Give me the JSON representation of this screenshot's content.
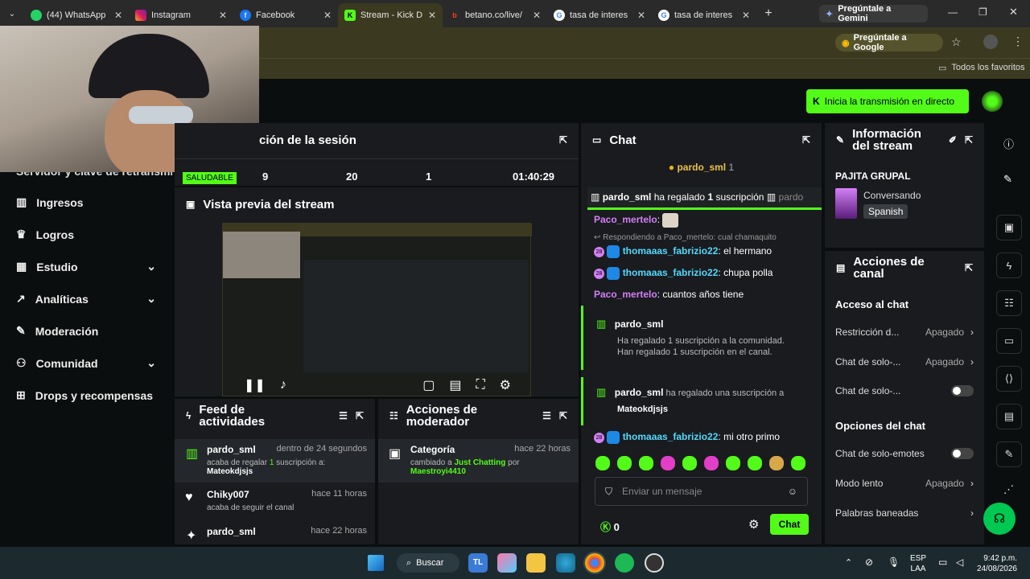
{
  "browser": {
    "tabs": [
      {
        "label": "(44) WhatsApp"
      },
      {
        "label": "Instagram"
      },
      {
        "label": "Facebook"
      },
      {
        "label": "Stream - Kick D"
      },
      {
        "label": "betano.co/live/"
      },
      {
        "label": "tasa de interes"
      },
      {
        "label": "tasa de interes"
      }
    ],
    "gemini_tab": "Pregúntale a Gemini",
    "ask_google": "Pregúntale a Google",
    "all_bookmarks": "Todos los favoritos"
  },
  "header": {
    "go_live": "Inicia la transmisión en directo"
  },
  "sidebar": {
    "partial": "Servidor y clave de retransmisión",
    "items": [
      {
        "label": "Ingresos"
      },
      {
        "label": "Logros"
      },
      {
        "label": "Estudio"
      },
      {
        "label": "Analíticas"
      },
      {
        "label": "Moderación"
      },
      {
        "label": "Comunidad"
      },
      {
        "label": "Drops y recompensas"
      }
    ]
  },
  "session": {
    "title": "ción de la sesión",
    "status": "SALUDABLE",
    "stats": [
      "9",
      "20",
      "1",
      "01:40:29"
    ]
  },
  "preview": {
    "title": "Vista previa del stream"
  },
  "activity": {
    "title": "Feed de actividades",
    "items": [
      {
        "user": "pardo_sml",
        "time": "dentro de 24 segundos",
        "pre": "acaba de regalar ",
        "num": "1",
        "post": " suscripción a:",
        "target": "Mateokdjsjs"
      },
      {
        "user": "Chiky007",
        "time": "hace 11 horas",
        "desc": "acaba de seguir el canal"
      },
      {
        "user": "pardo_sml",
        "time": "hace 22 horas"
      }
    ]
  },
  "modactions": {
    "title": "Acciones de moderador",
    "item": {
      "label": "Categoría",
      "time": "hace 22 horas",
      "pre": "cambiado a ",
      "cat": "Just Chatting",
      "by": " por ",
      "mod": "Maestroyi4410"
    }
  },
  "chat": {
    "title": "Chat",
    "pinned_user": "pardo_sml",
    "pinned_count": "1",
    "gift_banner": {
      "user": "pardo_sml",
      "pre": " ha regalado ",
      "num": "1",
      "post": " suscripción",
      "trail": "pardo"
    },
    "msgs": [
      {
        "user": "Paco_mertelo",
        "text": ":"
      },
      {
        "reply": "Respondiendo a Paco_mertelo: cual chamaquito"
      },
      {
        "user": "thomaaas_fabrizio22",
        "text": ": el hermano"
      },
      {
        "user": "thomaaas_fabrizio22",
        "text": ": chupa polla"
      },
      {
        "user": "Paco_mertelo",
        "text": ": cuantos años tiene"
      }
    ],
    "sub_event": {
      "user": "pardo_sml",
      "line1": "Ha regalado 1 suscripción a la comunidad.",
      "line2": "Han regalado 1 suscripción en el canal."
    },
    "gift_event": {
      "user": "pardo_sml",
      "text": " ha regalado una suscripción a",
      "target": "Mateokdjsjs"
    },
    "last": {
      "user": "thomaaas_fabrizio22",
      "text": ": mi otro primo"
    },
    "badge_num": "28",
    "placeholder": "Enviar un mensaje",
    "points": "0",
    "send": "Chat"
  },
  "streaminfo": {
    "title": "Información del stream",
    "stream_title": "PAJITA GRUPAL",
    "category": "Conversando",
    "language": "Spanish"
  },
  "channel": {
    "title": "Acciones de canal",
    "section1": "Acceso al chat",
    "rows1": [
      {
        "label": "Restricción d...",
        "value": "Apagado"
      },
      {
        "label": "Chat de solo-...",
        "value": "Apagado"
      },
      {
        "label": "Chat de solo-...",
        "value": ""
      }
    ],
    "section2": "Opciones del chat",
    "rows2": [
      {
        "label": "Chat de solo-emotes",
        "value": ""
      },
      {
        "label": "Modo lento",
        "value": "Apagado"
      },
      {
        "label": "Palabras baneadas",
        "value": ""
      }
    ]
  },
  "taskbar": {
    "search": "Buscar",
    "lang1": "ESP",
    "lang2": "LAA",
    "time": "9:42 p.m.",
    "date": "24/08/2026"
  },
  "colors": {
    "accent": "#53fc18",
    "panel": "#191b1f",
    "purple": "#d37ff5"
  }
}
